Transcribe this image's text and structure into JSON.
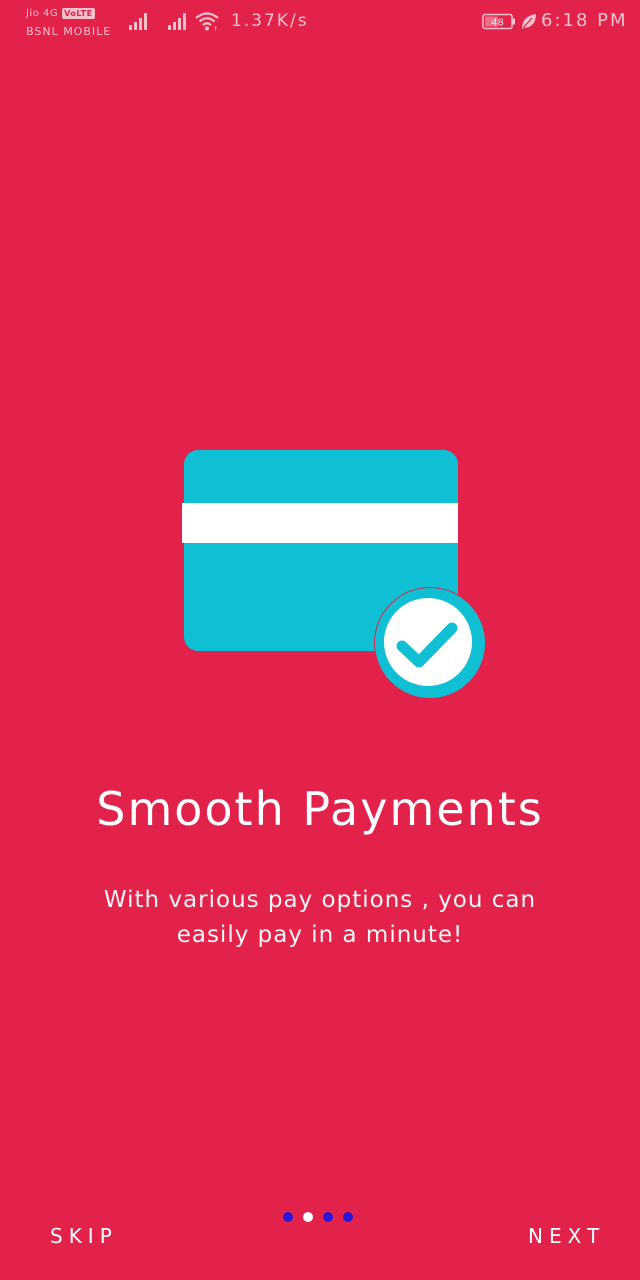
{
  "status_bar": {
    "carrier_primary": "Jio 4G",
    "volte_badge": "VoLTE",
    "carrier_secondary": "BSNL MOBILE",
    "network_speed": "1.37K/s",
    "battery_level": "48",
    "time": "6:18 PM",
    "icons": [
      "signal-icon",
      "signal-icon",
      "wifi-icon",
      "battery-icon",
      "leaf-icon"
    ]
  },
  "onboarding": {
    "illustration_icon": "credit-card-check-icon",
    "title": "Smooth Payments",
    "description": "With various pay options , you can easily pay in a minute!",
    "page_count": 4,
    "active_page": 2
  },
  "navigation": {
    "skip_label": "SKIP",
    "next_label": "NEXT"
  },
  "colors": {
    "background": "#e2224a",
    "card": "#0fc0d4",
    "stripe": "#ffffff",
    "dot_inactive": "#2a16d8",
    "dot_active": "#ffffff"
  }
}
